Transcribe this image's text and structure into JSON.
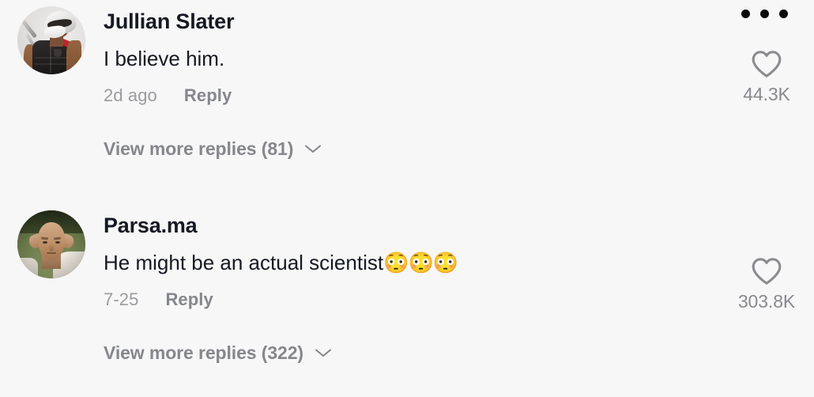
{
  "app": {
    "background_color": "#f7f7f7",
    "text_color": "#161823",
    "muted_color": "#86878b"
  },
  "overflow_menu": {
    "icon": "three-dots-icon",
    "label": "More options"
  },
  "comments": [
    {
      "username": "Jullian Slater",
      "avatar": "soldier-in-tactical-vest-avatar",
      "text": "I believe him.",
      "emoji": "",
      "timestamp": "2d ago",
      "reply_label": "Reply",
      "view_more_label": "View more replies (81)",
      "reply_count": 81,
      "like_count": "44.3K",
      "like_icon": "heart-outline-icon",
      "chevron_icon": "chevron-down-icon"
    },
    {
      "username": "Parsa.ma",
      "avatar": "bald-man-in-field-avatar",
      "text": "He might be an actual scientist",
      "emoji": "😳😳😳",
      "timestamp": "7-25",
      "reply_label": "Reply",
      "view_more_label": "View more replies (322)",
      "reply_count": 322,
      "like_count": "303.8K",
      "like_icon": "heart-outline-icon",
      "chevron_icon": "chevron-down-icon"
    }
  ]
}
